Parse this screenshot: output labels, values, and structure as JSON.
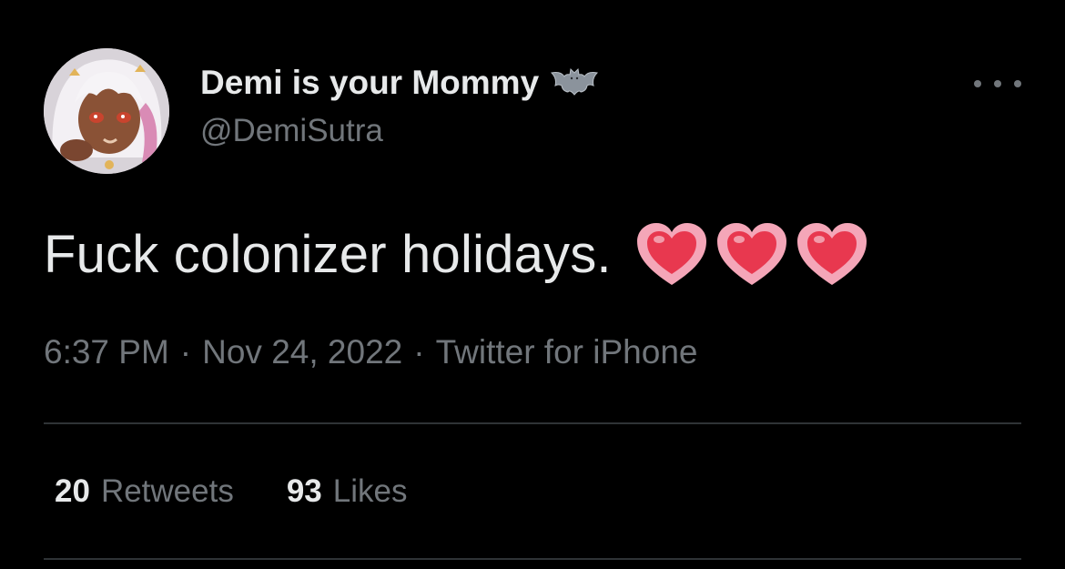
{
  "author": {
    "display_name": "Demi is your Mommy",
    "badge_icon": "bat-icon",
    "handle": "@DemiSutra",
    "avatar_icon": "anime-avatar-icon"
  },
  "menu": {
    "more_icon": "more-dots-icon"
  },
  "tweet": {
    "text": "Fuck colonizer holidays.",
    "emoji": [
      "heart-icon",
      "heart-icon",
      "heart-icon"
    ]
  },
  "meta": {
    "time": "6:37 PM",
    "separator": "·",
    "date": "Nov 24, 2022",
    "source": "Twitter for iPhone"
  },
  "stats": {
    "retweets_count": "20",
    "retweets_label": "Retweets",
    "likes_count": "93",
    "likes_label": "Likes"
  },
  "colors": {
    "background": "#000000",
    "primary_text": "#e7e9ea",
    "secondary_text": "#71767b",
    "divider": "#2f3336",
    "heart_outer": "#f4a6b8",
    "heart_inner": "#e8384f"
  }
}
